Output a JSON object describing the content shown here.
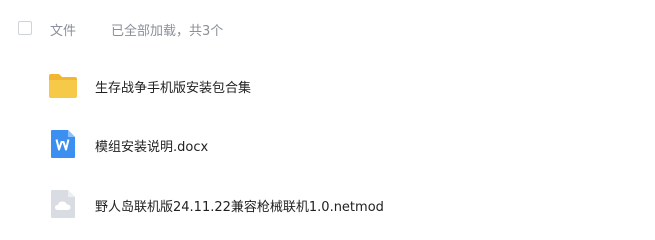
{
  "header": {
    "column_title": "文件",
    "load_status": "已全部加载，共3个"
  },
  "files": [
    {
      "name": "生存战争手机版安装包合集",
      "icon": "folder-icon"
    },
    {
      "name": "模组安装说明.docx",
      "icon": "word-document-icon"
    },
    {
      "name": "野人岛联机版24.11.22兼容枪械联机1.0.netmod",
      "icon": "cloud-file-icon"
    }
  ],
  "colors": {
    "folder": "#f7c948",
    "word": "#3a8ff0",
    "generic_file": "#d9dde3",
    "muted_text": "#8a8f99"
  }
}
